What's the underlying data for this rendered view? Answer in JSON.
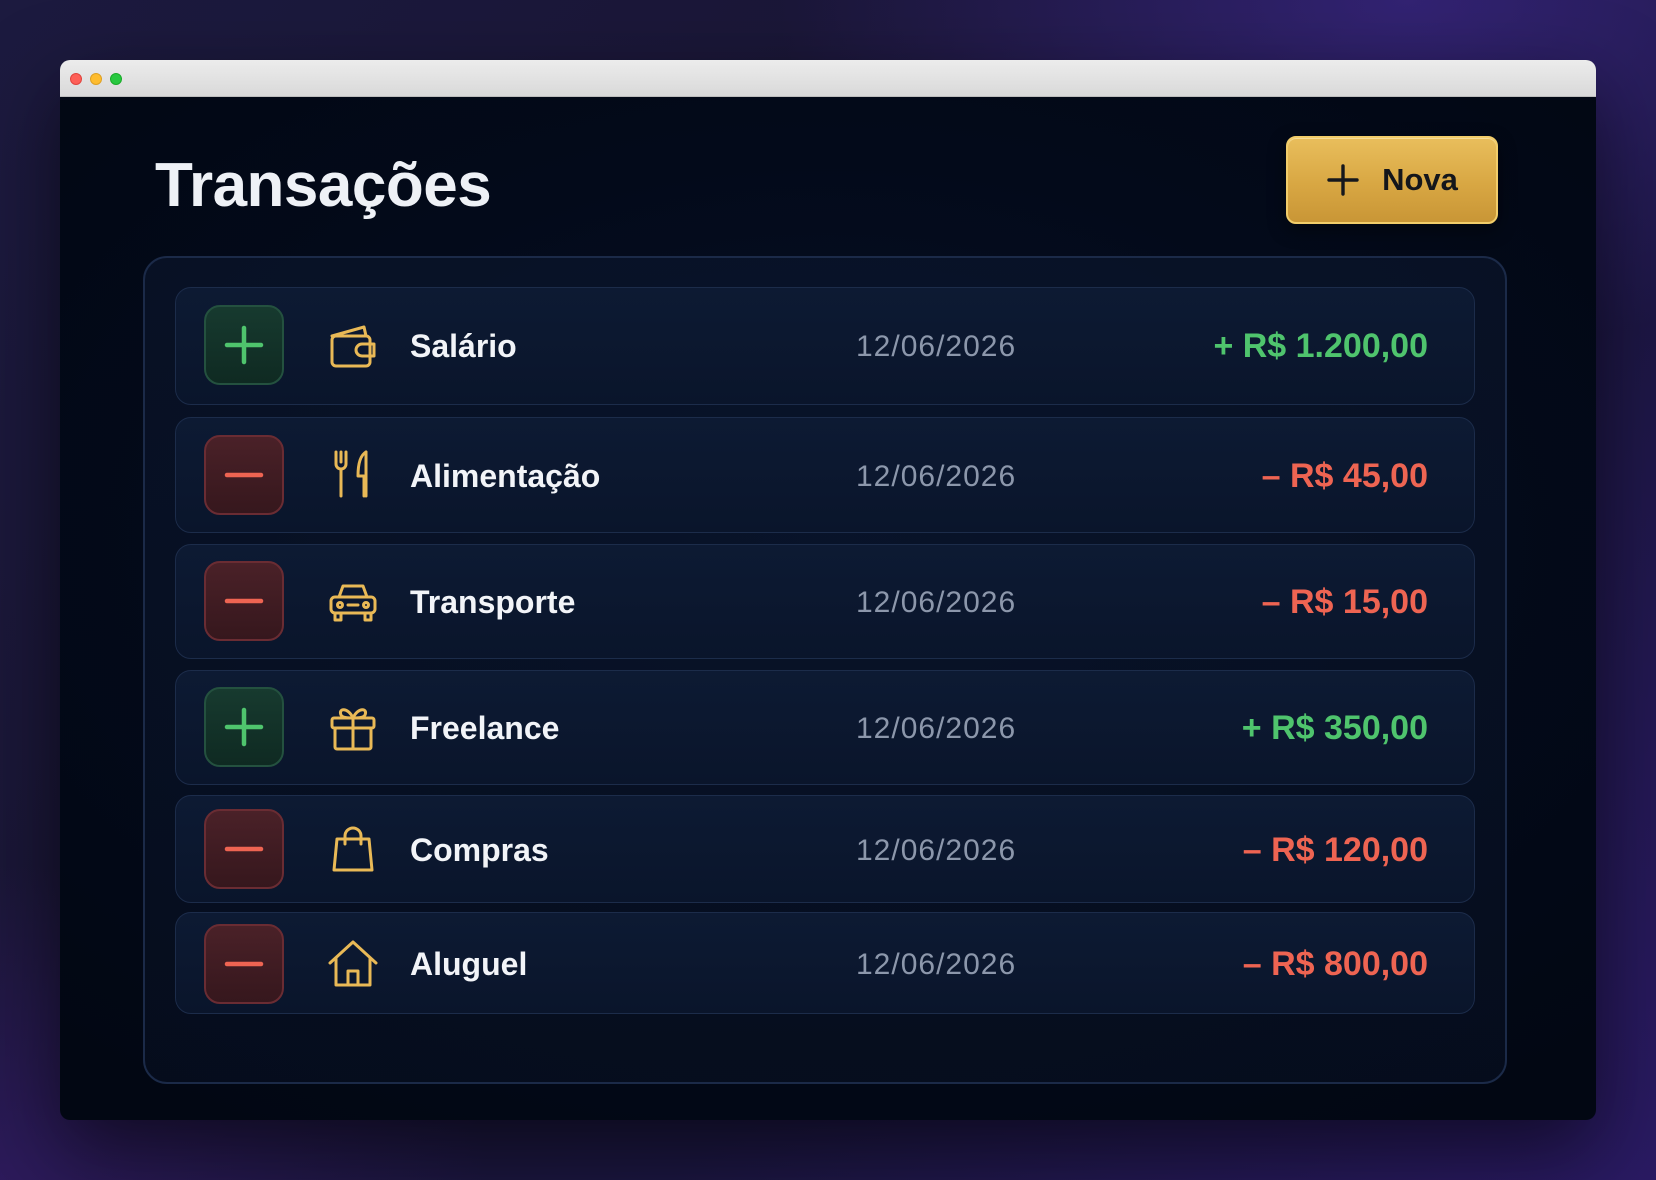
{
  "app": {
    "title": "Transações",
    "new_button_label": "Nova"
  },
  "colors": {
    "income": "#4fc46d",
    "expense": "#ee6452",
    "accent": "#e0b24f",
    "icon_gold": "#e9b956"
  },
  "transactions": [
    {
      "type": "income",
      "type_icon": "plus-icon",
      "category_icon": "wallet-icon",
      "name": "Salário",
      "date": "12/06/2026",
      "amount": "+ R$ 1.200,00"
    },
    {
      "type": "expense",
      "type_icon": "minus-icon",
      "category_icon": "fork-knife-icon",
      "name": "Alimentação",
      "date": "12/06/2026",
      "amount": "– R$ 45,00"
    },
    {
      "type": "expense",
      "type_icon": "minus-icon",
      "category_icon": "car-icon",
      "name": "Transporte",
      "date": "12/06/2026",
      "amount": "– R$ 15,00"
    },
    {
      "type": "income",
      "type_icon": "plus-icon",
      "category_icon": "gift-icon",
      "name": "Freelance",
      "date": "12/06/2026",
      "amount": "+ R$ 350,00"
    },
    {
      "type": "expense",
      "type_icon": "minus-icon",
      "category_icon": "shopping-bag-icon",
      "name": "Compras",
      "date": "12/06/2026",
      "amount": "– R$ 120,00"
    },
    {
      "type": "expense",
      "type_icon": "minus-icon",
      "category_icon": "house-icon",
      "name": "Aluguel",
      "date": "12/06/2026",
      "amount": "– R$ 800,00"
    }
  ]
}
